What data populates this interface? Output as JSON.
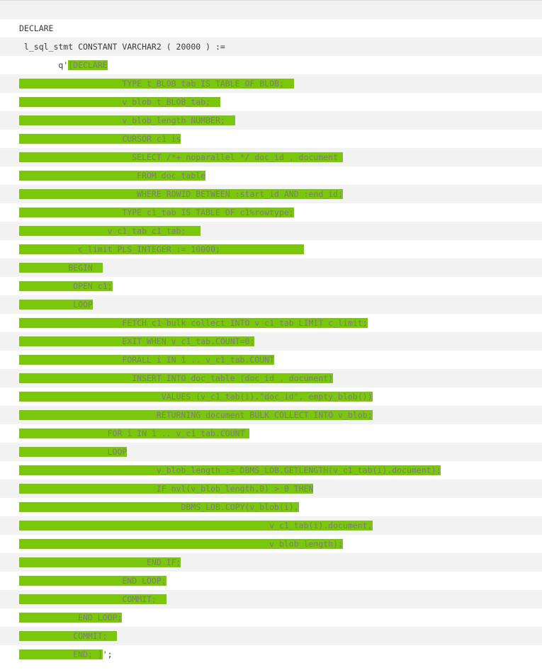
{
  "document": {
    "language": "PL/SQL",
    "highlight_color": "#7ac70c",
    "highlight_text_color": "#7d7d7d",
    "plain_text_color": "#3a3a3a",
    "stripe_color": "#f2f2f2",
    "background_color": "#ffffff"
  },
  "lines": [
    {
      "n": 1,
      "stripe": "odd",
      "segments": []
    },
    {
      "n": 2,
      "stripe": "even",
      "segments": [
        {
          "t": "DECLARE",
          "h": false
        }
      ]
    },
    {
      "n": 3,
      "stripe": "odd",
      "segments": [
        {
          "t": " l_sql_stmt CONSTANT VARCHAR2 ( 20000 ) :=",
          "h": false
        }
      ]
    },
    {
      "n": 4,
      "stripe": "even",
      "segments": [
        {
          "t": "        q'",
          "h": false
        },
        {
          "t": "[DECLARE",
          "h": true
        }
      ]
    },
    {
      "n": 5,
      "stripe": "odd",
      "segments": [
        {
          "t": "                     TYPE t_BLOB_tab IS TABLE OF BLOB;  ",
          "h": true
        }
      ]
    },
    {
      "n": 6,
      "stripe": "even",
      "segments": [
        {
          "t": "                     v_blob t_BLOB_tab;  ",
          "h": true
        }
      ]
    },
    {
      "n": 7,
      "stripe": "odd",
      "segments": [
        {
          "t": "                     v_blob_length NUMBER;  ",
          "h": true
        }
      ]
    },
    {
      "n": 8,
      "stripe": "even",
      "segments": [
        {
          "t": "                     CURSOR c1 is",
          "h": true
        }
      ]
    },
    {
      "n": 9,
      "stripe": "odd",
      "segments": [
        {
          "t": "                       SELECT /*+ noparallel */ doc_id , document ",
          "h": true
        }
      ]
    },
    {
      "n": 10,
      "stripe": "even",
      "segments": [
        {
          "t": "                        FROM doc_table",
          "h": true
        }
      ]
    },
    {
      "n": 11,
      "stripe": "odd",
      "segments": [
        {
          "t": "                        WHERE ROWID BETWEEN :start_id AND :end_id;",
          "h": true
        }
      ]
    },
    {
      "n": 12,
      "stripe": "even",
      "segments": [
        {
          "t": "                     TYPE c1_tab IS TABLE OF c1%rowtype;",
          "h": true
        }
      ]
    },
    {
      "n": 13,
      "stripe": "odd",
      "segments": [
        {
          "t": "                  v_c1_tab c1_tab;   ",
          "h": true
        }
      ]
    },
    {
      "n": 14,
      "stripe": "even",
      "segments": [
        {
          "t": "            c_limit PLS_INTEGER := 10000;                 ",
          "h": true
        }
      ]
    },
    {
      "n": 15,
      "stripe": "odd",
      "segments": [
        {
          "t": "          BEGIN  ",
          "h": true
        }
      ]
    },
    {
      "n": 16,
      "stripe": "even",
      "segments": [
        {
          "t": "           OPEN c1;",
          "h": true
        }
      ]
    },
    {
      "n": 17,
      "stripe": "odd",
      "segments": [
        {
          "t": "           LOOP",
          "h": true
        }
      ]
    },
    {
      "n": 18,
      "stripe": "even",
      "segments": [
        {
          "t": "                     FETCH c1 bulk collect INTO v_c1_tab LIMIT c_limit;",
          "h": true
        }
      ]
    },
    {
      "n": 19,
      "stripe": "odd",
      "segments": [
        {
          "t": "                     EXIT WHEN v_c1_tab.COUNT=0;",
          "h": true
        }
      ]
    },
    {
      "n": 20,
      "stripe": "even",
      "segments": [
        {
          "t": "                     FORALL i IN 1 .. v_c1_tab.COUNT",
          "h": true
        }
      ]
    },
    {
      "n": 21,
      "stripe": "odd",
      "segments": [
        {
          "t": "                       INSERT INTO doc_table (doc_id , document)",
          "h": true
        }
      ]
    },
    {
      "n": 22,
      "stripe": "even",
      "segments": [
        {
          "t": "                             VALUES (v_c1_tab(i).\"doc_id\", empty_blob())",
          "h": true
        }
      ]
    },
    {
      "n": 23,
      "stripe": "odd",
      "segments": [
        {
          "t": "                            RETURNING document BULK COLLECT INTO v_blob;",
          "h": true
        }
      ]
    },
    {
      "n": 24,
      "stripe": "even",
      "segments": [
        {
          "t": "                  FOR i IN 1 .. v_c1_tab.COUNT ",
          "h": true
        }
      ]
    },
    {
      "n": 25,
      "stripe": "odd",
      "segments": [
        {
          "t": "                  LOOP",
          "h": true
        }
      ]
    },
    {
      "n": 26,
      "stripe": "even",
      "segments": [
        {
          "t": "                            v_blob_length := DBMS_LOB.GETLENGTH(v_c1_tab(i).document);",
          "h": true
        }
      ]
    },
    {
      "n": 27,
      "stripe": "odd",
      "segments": [
        {
          "t": "                            IF nvl(v_blob_length,0) > 0 THEN",
          "h": true
        }
      ]
    },
    {
      "n": 28,
      "stripe": "even",
      "segments": [
        {
          "t": "                                 DBMS_LOB.COPY(v_blob(i),",
          "h": true
        }
      ]
    },
    {
      "n": 29,
      "stripe": "odd",
      "segments": [
        {
          "t": "                                                   v_c1_tab(i).document,",
          "h": true
        }
      ]
    },
    {
      "n": 30,
      "stripe": "even",
      "segments": [
        {
          "t": "                                                   v_blob_length);",
          "h": true
        }
      ]
    },
    {
      "n": 31,
      "stripe": "odd",
      "segments": [
        {
          "t": "                          END IF;",
          "h": true
        }
      ]
    },
    {
      "n": 32,
      "stripe": "even",
      "segments": [
        {
          "t": "                     END LOOP;",
          "h": true
        }
      ]
    },
    {
      "n": 33,
      "stripe": "odd",
      "segments": [
        {
          "t": "                     COMMIT;  ",
          "h": true
        }
      ]
    },
    {
      "n": 34,
      "stripe": "even",
      "segments": [
        {
          "t": "            END LOOP;",
          "h": true
        }
      ]
    },
    {
      "n": 35,
      "stripe": "odd",
      "segments": [
        {
          "t": "           COMMIT;  ",
          "h": true
        }
      ]
    },
    {
      "n": 36,
      "stripe": "even",
      "segments": [
        {
          "t": "           END; ]",
          "h": true
        },
        {
          "t": "';",
          "h": false
        }
      ]
    }
  ]
}
